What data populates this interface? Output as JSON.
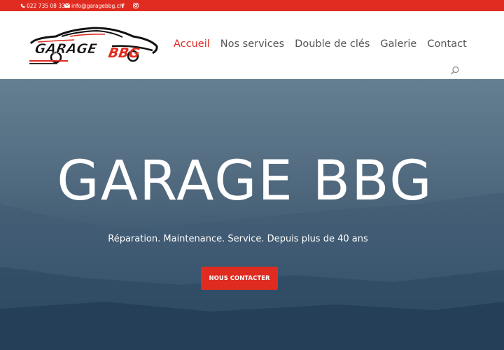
{
  "topbar": {
    "phone": "022 735 08 33",
    "email": "info@garagebbg.ch",
    "facebook_glyph": "f",
    "icons": [
      "phone-icon",
      "mail-icon",
      "facebook-icon",
      "instagram-icon"
    ],
    "bg_color": "#e02b20"
  },
  "header": {
    "logo_text_main": "GARAGE",
    "logo_text_accent": "BBG",
    "nav": [
      {
        "label": "Accueil",
        "active": true
      },
      {
        "label": "Nos services",
        "active": false
      },
      {
        "label": "Double de clés",
        "active": false
      },
      {
        "label": "Galerie",
        "active": false
      },
      {
        "label": "Contact",
        "active": false
      }
    ],
    "search_icon": "search-icon"
  },
  "hero": {
    "title": "GARAGE BBG",
    "subtitle": "Réparation. Maintenance. Service. Depuis plus de 40 ans",
    "cta_label": "NOUS CONTACTER",
    "accent_color": "#e02b20"
  }
}
